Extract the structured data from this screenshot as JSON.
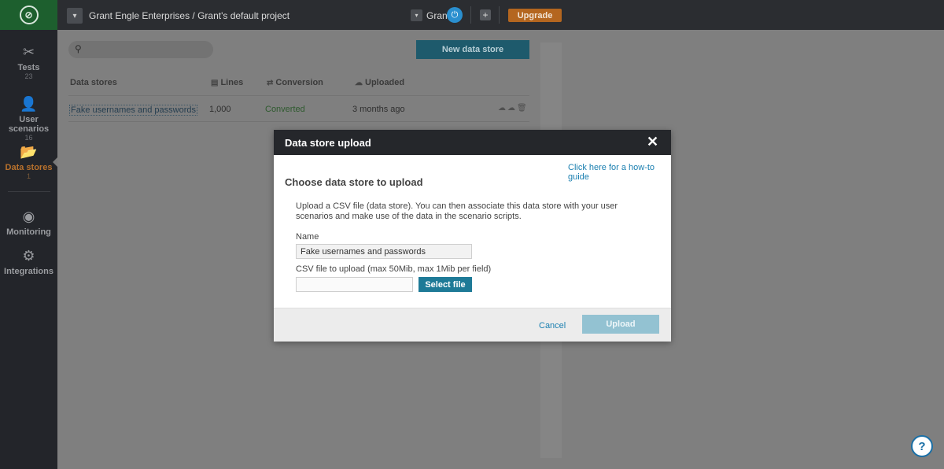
{
  "topbar": {
    "logo_icon": "brand-logo-icon",
    "project_path": "Grant Engle Enterprises / Grant's default project",
    "user_name": "Grant",
    "upgrade_label": "Upgrade",
    "plus_glyph": "+",
    "dropdown_glyph": "▾"
  },
  "sidebar": {
    "items": [
      {
        "icon": "tools-icon",
        "glyph": "✂",
        "label": "Tests",
        "count": "23"
      },
      {
        "icon": "user-scenario-icon",
        "glyph": "👤",
        "label": "User scenarios",
        "count": "16"
      },
      {
        "icon": "folder-icon",
        "glyph": "📂",
        "label": "Data stores",
        "count": "1"
      },
      {
        "icon": "binoculars-icon",
        "glyph": "◉",
        "label": "Monitoring",
        "count": ""
      },
      {
        "icon": "puzzle-icon",
        "glyph": "⚙",
        "label": "Integrations",
        "count": ""
      }
    ],
    "active_index": 2
  },
  "main": {
    "search_placeholder": "",
    "new_button_label": "New data store",
    "columns": [
      "Data stores",
      "Lines",
      "Conversion",
      "Uploaded"
    ],
    "rows": [
      {
        "name": "Fake usernames and passwords",
        "lines": "1,000",
        "conversion": "Converted",
        "uploaded": "3 months ago"
      }
    ]
  },
  "modal": {
    "title": "Data store upload",
    "close_glyph": "✕",
    "howto_link": "Click here for a how-to guide",
    "section_title": "Choose data store to upload",
    "description": "Upload a CSV file (data store). You can then associate this data store with your user scenarios and make use of the data in the scenario scripts.",
    "name_label": "Name",
    "name_value": "Fake usernames and passwords",
    "csv_label": "CSV file to upload (max 50Mib, max 1Mib per field)",
    "select_file_label": "Select file",
    "cancel_label": "Cancel",
    "upload_label": "Upload"
  },
  "help": {
    "glyph": "?"
  },
  "colors": {
    "accent": "#1e7a97",
    "active_nav": "#b8712c",
    "upgrade": "#b4661f",
    "logo_bg": "#1d5f2e"
  }
}
